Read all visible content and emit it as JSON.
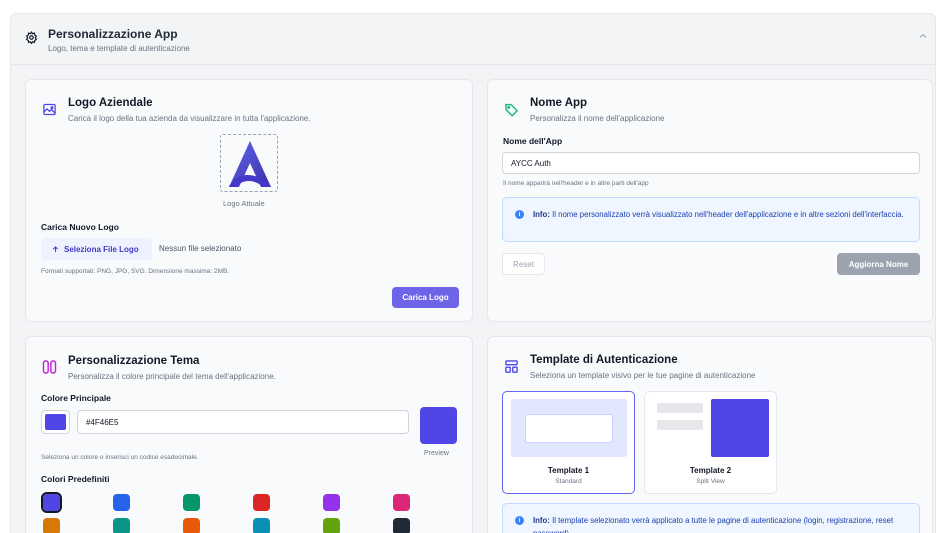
{
  "header": {
    "title": "Personalizzazione App",
    "subtitle": "Logo, tema e template di autenticazione"
  },
  "logo_card": {
    "title": "Logo Aziendale",
    "subtitle": "Carica il logo della tua azienda da visualizzare in tutta l'applicazione.",
    "current_logo_caption": "Logo Attuale",
    "upload_label": "Carica Nuovo Logo",
    "file_button": "Seleziona File Logo",
    "file_status": "Nessun file selezionato",
    "formats_hint": "Formati supportati: PNG, JPG, SVG. Dimensione massima: 2MB.",
    "upload_button": "Carica Logo"
  },
  "name_card": {
    "title": "Nome App",
    "subtitle": "Personalizza il nome dell'applicazione",
    "field_label": "Nome dell'App",
    "field_value": "AYCC Auth",
    "field_hint": "Il nome apparirà nell'header e in altre parti dell'app",
    "info_label": "Info:",
    "info_text": "Il nome personalizzato verrà visualizzato nell'header dell'applicazione e in altre sezioni dell'interfaccia.",
    "reset_button": "Reset",
    "update_button": "Aggiorna Nome"
  },
  "theme_card": {
    "title": "Personalizzazione Tema",
    "subtitle": "Personalizza il colore principale del tema dell'applicazione.",
    "primary_label": "Colore Principale",
    "primary_value": "#4F46E5",
    "primary_color": "#4f46e5",
    "primary_hint": "Seleziona un colore o inserisci un codice esadecimale.",
    "preview_label": "Preview",
    "presets_label": "Colori Predefiniti",
    "presets": [
      "#4f46e5",
      "#2563eb",
      "#059669",
      "#dc2626",
      "#9333ea",
      "#db2777",
      "#d97706",
      "#0d9488",
      "#ea580c",
      "#0891b2",
      "#65a30d",
      "#1f2937"
    ]
  },
  "template_card": {
    "title": "Template di Autenticazione",
    "subtitle": "Seleziona un template visivo per le tue pagine di autenticazione",
    "templates": [
      {
        "name": "Template 1",
        "desc": "Standard"
      },
      {
        "name": "Template 2",
        "desc": "Split View"
      }
    ],
    "info_label": "Info:",
    "info_text": "Il template selezionato verrà applicato a tutte le pagine di autenticazione (login, registrazione, reset password)."
  },
  "colors": {
    "accent": "#6d64e8",
    "logo_purple": "#4f46e5",
    "green_icon": "#10b981",
    "info_bg": "#eff6ff"
  }
}
